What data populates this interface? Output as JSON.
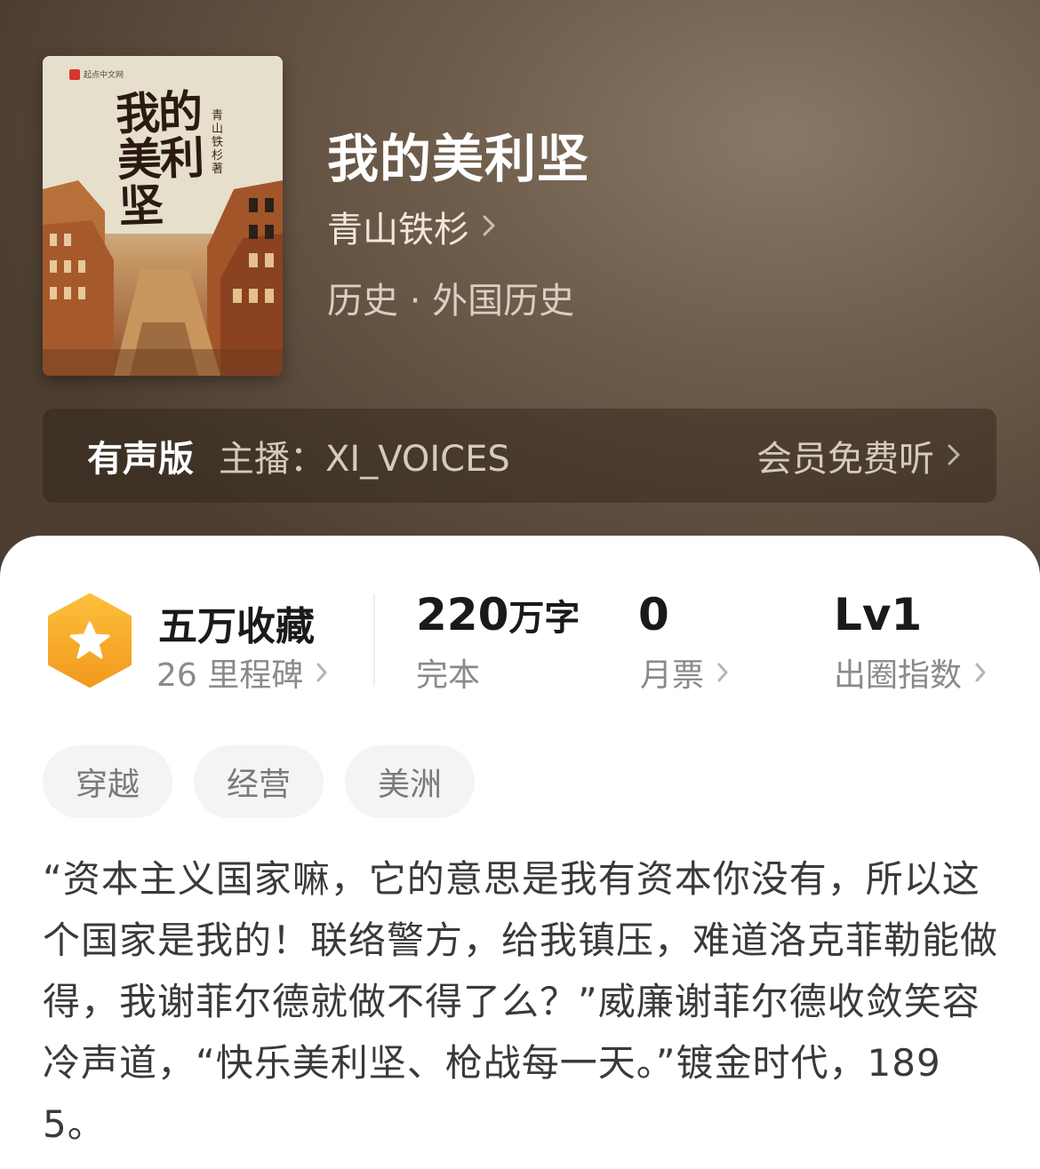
{
  "book": {
    "cover": {
      "brand": "起点中文网",
      "title": "我的美利坚",
      "author": "青山铁杉著"
    },
    "title": "我的美利坚",
    "author": "青山铁杉",
    "genre": "历史 · 外国历史"
  },
  "audio": {
    "label": "有声版",
    "host": "主播：XI_VOICES",
    "cta": "会员免费听"
  },
  "stats": {
    "collection": {
      "main": "五万收藏",
      "sub": "26 里程碑"
    },
    "words": {
      "number": "220",
      "unit": "万字",
      "sub": "完本"
    },
    "tickets": {
      "main": "0",
      "sub": "月票"
    },
    "index": {
      "main": "Lv1",
      "sub": "出圈指数"
    }
  },
  "tags": [
    "穿越",
    "经营",
    "美洲"
  ],
  "description": "“资本主义国家嘛，它的意思是我有资本你没有，所以这个国家是我的！联络警方，给我镇压，难道洛克菲勒能做得，我谢菲尔德就做不得了么？”威廉谢菲尔德收敛笑容冷声道，“快乐美利坚、枪战每一天。”镀金时代，1895。",
  "colors": {
    "header_bg": "#6d5b4a",
    "badge_orange": "#f5a623",
    "text_primary": "#1a1a1a",
    "text_secondary": "#8a8a8a"
  }
}
